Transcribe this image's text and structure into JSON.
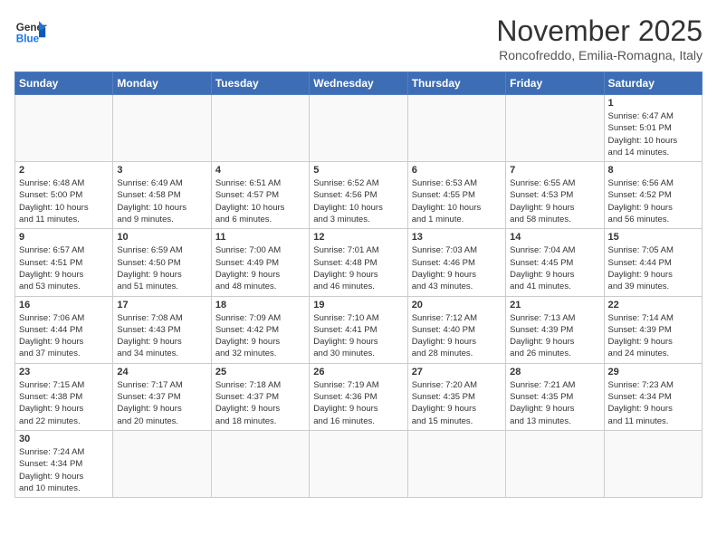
{
  "header": {
    "logo_general": "General",
    "logo_blue": "Blue",
    "month_title": "November 2025",
    "subtitle": "Roncofreddo, Emilia-Romagna, Italy"
  },
  "days_of_week": [
    "Sunday",
    "Monday",
    "Tuesday",
    "Wednesday",
    "Thursday",
    "Friday",
    "Saturday"
  ],
  "weeks": [
    [
      {
        "day": "",
        "info": ""
      },
      {
        "day": "",
        "info": ""
      },
      {
        "day": "",
        "info": ""
      },
      {
        "day": "",
        "info": ""
      },
      {
        "day": "",
        "info": ""
      },
      {
        "day": "",
        "info": ""
      },
      {
        "day": "1",
        "info": "Sunrise: 6:47 AM\nSunset: 5:01 PM\nDaylight: 10 hours\nand 14 minutes."
      }
    ],
    [
      {
        "day": "2",
        "info": "Sunrise: 6:48 AM\nSunset: 5:00 PM\nDaylight: 10 hours\nand 11 minutes."
      },
      {
        "day": "3",
        "info": "Sunrise: 6:49 AM\nSunset: 4:58 PM\nDaylight: 10 hours\nand 9 minutes."
      },
      {
        "day": "4",
        "info": "Sunrise: 6:51 AM\nSunset: 4:57 PM\nDaylight: 10 hours\nand 6 minutes."
      },
      {
        "day": "5",
        "info": "Sunrise: 6:52 AM\nSunset: 4:56 PM\nDaylight: 10 hours\nand 3 minutes."
      },
      {
        "day": "6",
        "info": "Sunrise: 6:53 AM\nSunset: 4:55 PM\nDaylight: 10 hours\nand 1 minute."
      },
      {
        "day": "7",
        "info": "Sunrise: 6:55 AM\nSunset: 4:53 PM\nDaylight: 9 hours\nand 58 minutes."
      },
      {
        "day": "8",
        "info": "Sunrise: 6:56 AM\nSunset: 4:52 PM\nDaylight: 9 hours\nand 56 minutes."
      }
    ],
    [
      {
        "day": "9",
        "info": "Sunrise: 6:57 AM\nSunset: 4:51 PM\nDaylight: 9 hours\nand 53 minutes."
      },
      {
        "day": "10",
        "info": "Sunrise: 6:59 AM\nSunset: 4:50 PM\nDaylight: 9 hours\nand 51 minutes."
      },
      {
        "day": "11",
        "info": "Sunrise: 7:00 AM\nSunset: 4:49 PM\nDaylight: 9 hours\nand 48 minutes."
      },
      {
        "day": "12",
        "info": "Sunrise: 7:01 AM\nSunset: 4:48 PM\nDaylight: 9 hours\nand 46 minutes."
      },
      {
        "day": "13",
        "info": "Sunrise: 7:03 AM\nSunset: 4:46 PM\nDaylight: 9 hours\nand 43 minutes."
      },
      {
        "day": "14",
        "info": "Sunrise: 7:04 AM\nSunset: 4:45 PM\nDaylight: 9 hours\nand 41 minutes."
      },
      {
        "day": "15",
        "info": "Sunrise: 7:05 AM\nSunset: 4:44 PM\nDaylight: 9 hours\nand 39 minutes."
      }
    ],
    [
      {
        "day": "16",
        "info": "Sunrise: 7:06 AM\nSunset: 4:44 PM\nDaylight: 9 hours\nand 37 minutes."
      },
      {
        "day": "17",
        "info": "Sunrise: 7:08 AM\nSunset: 4:43 PM\nDaylight: 9 hours\nand 34 minutes."
      },
      {
        "day": "18",
        "info": "Sunrise: 7:09 AM\nSunset: 4:42 PM\nDaylight: 9 hours\nand 32 minutes."
      },
      {
        "day": "19",
        "info": "Sunrise: 7:10 AM\nSunset: 4:41 PM\nDaylight: 9 hours\nand 30 minutes."
      },
      {
        "day": "20",
        "info": "Sunrise: 7:12 AM\nSunset: 4:40 PM\nDaylight: 9 hours\nand 28 minutes."
      },
      {
        "day": "21",
        "info": "Sunrise: 7:13 AM\nSunset: 4:39 PM\nDaylight: 9 hours\nand 26 minutes."
      },
      {
        "day": "22",
        "info": "Sunrise: 7:14 AM\nSunset: 4:39 PM\nDaylight: 9 hours\nand 24 minutes."
      }
    ],
    [
      {
        "day": "23",
        "info": "Sunrise: 7:15 AM\nSunset: 4:38 PM\nDaylight: 9 hours\nand 22 minutes."
      },
      {
        "day": "24",
        "info": "Sunrise: 7:17 AM\nSunset: 4:37 PM\nDaylight: 9 hours\nand 20 minutes."
      },
      {
        "day": "25",
        "info": "Sunrise: 7:18 AM\nSunset: 4:37 PM\nDaylight: 9 hours\nand 18 minutes."
      },
      {
        "day": "26",
        "info": "Sunrise: 7:19 AM\nSunset: 4:36 PM\nDaylight: 9 hours\nand 16 minutes."
      },
      {
        "day": "27",
        "info": "Sunrise: 7:20 AM\nSunset: 4:35 PM\nDaylight: 9 hours\nand 15 minutes."
      },
      {
        "day": "28",
        "info": "Sunrise: 7:21 AM\nSunset: 4:35 PM\nDaylight: 9 hours\nand 13 minutes."
      },
      {
        "day": "29",
        "info": "Sunrise: 7:23 AM\nSunset: 4:34 PM\nDaylight: 9 hours\nand 11 minutes."
      }
    ],
    [
      {
        "day": "30",
        "info": "Sunrise: 7:24 AM\nSunset: 4:34 PM\nDaylight: 9 hours\nand 10 minutes."
      },
      {
        "day": "",
        "info": ""
      },
      {
        "day": "",
        "info": ""
      },
      {
        "day": "",
        "info": ""
      },
      {
        "day": "",
        "info": ""
      },
      {
        "day": "",
        "info": ""
      },
      {
        "day": "",
        "info": ""
      }
    ]
  ]
}
